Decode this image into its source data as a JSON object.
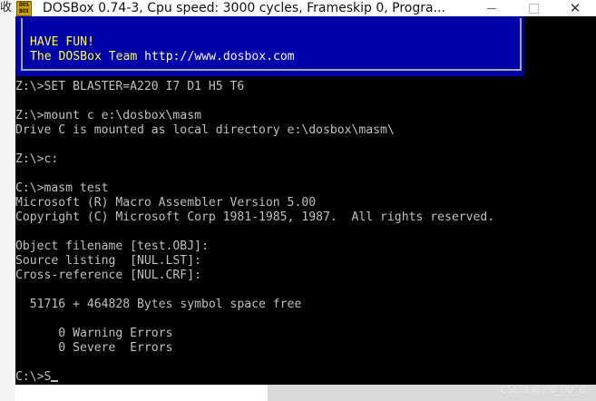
{
  "left_window": {
    "glyph": "收"
  },
  "window": {
    "icon_text_top": "DOS",
    "icon_text_bottom": "BOX",
    "title": "DOSBox 0.74-3, Cpu speed:     3000 cycles, Frameskip  0, Progra...",
    "minimize_icon": "minimize-icon",
    "maximize_icon": "maximize-icon",
    "close_icon": "close-icon",
    "close_glyph": "✕"
  },
  "banner": {
    "line1": "HAVE FUN!",
    "line2_prefix": "The DOSBox Team ",
    "line2_url": "http://www.dosbox.com"
  },
  "console_lines": [
    "Z:\\>SET BLASTER=A220 I7 D1 H5 T6",
    "",
    "Z:\\>mount c e:\\dosbox\\masm",
    "Drive C is mounted as local directory e:\\dosbox\\masm\\",
    "",
    "Z:\\>c:",
    "",
    "C:\\>masm test",
    "Microsoft (R) Macro Assembler Version 5.00",
    "Copyright (C) Microsoft Corp 1981-1985, 1987.  All rights reserved.",
    "",
    "Object filename [test.OBJ]:",
    "Source listing  [NUL.LST]:",
    "Cross-reference [NUL.CRF]:",
    "",
    "  51716 + 464828 Bytes symbol space free",
    "",
    "      0 Warning Errors",
    "      0 Severe  Errors",
    "",
    "C:\\>S"
  ],
  "watermark": "CSDN @zl0_00_0",
  "colors": {
    "banner_bg": "#0000a8",
    "banner_text": "#ffff54",
    "console_text": "#c0c0c0"
  }
}
